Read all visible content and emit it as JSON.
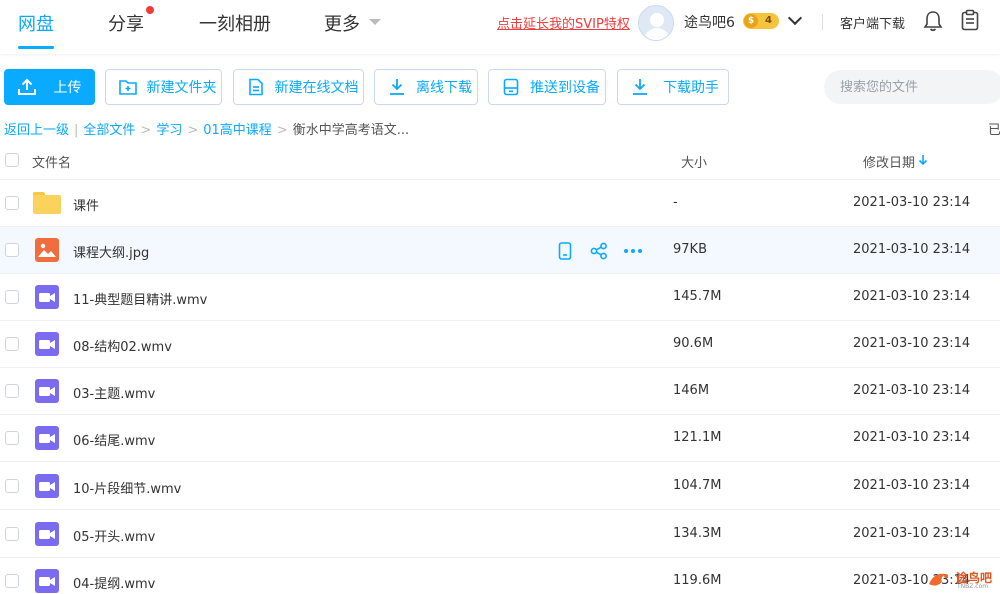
{
  "nav": {
    "tabs": [
      {
        "label": "网盘",
        "active": true
      },
      {
        "label": "分享",
        "active": false,
        "dot": true
      },
      {
        "label": "一刻相册",
        "active": false
      },
      {
        "label": "更多",
        "active": false,
        "dropdown": true
      }
    ]
  },
  "header": {
    "promo": "点击延长我的SVIP特权",
    "username": "途鸟吧6",
    "vip_level": "4",
    "vip_coin": "$",
    "client_download": "客户端下载",
    "bell_icon": "bell-icon",
    "clipboard_icon": "clipboard-icon"
  },
  "toolbar": {
    "upload": "上传",
    "new_folder": "新建文件夹",
    "new_doc": "新建在线文档",
    "offline_download": "离线下载",
    "push_device": "推送到设备",
    "download_helper": "下载助手",
    "search_placeholder": "搜索您的文件"
  },
  "breadcrumb": {
    "back": "返回上一级",
    "items": [
      "全部文件",
      "学习",
      "01高中课程"
    ],
    "current": "衡水中学高考语文...",
    "right_cut": "已"
  },
  "table": {
    "col_name": "文件名",
    "col_size": "大小",
    "col_date": "修改日期",
    "rows": [
      {
        "name": "课件",
        "size": "-",
        "date": "2021-03-10 23:14",
        "type": "folder"
      },
      {
        "name": "课程大纲.jpg",
        "size": "97KB",
        "date": "2021-03-10 23:14",
        "type": "image"
      },
      {
        "name": "11-典型题目精讲.wmv",
        "size": "145.7M",
        "date": "2021-03-10 23:14",
        "type": "video"
      },
      {
        "name": "08-结构02.wmv",
        "size": "90.6M",
        "date": "2021-03-10 23:14",
        "type": "video"
      },
      {
        "name": "03-主题.wmv",
        "size": "146M",
        "date": "2021-03-10 23:14",
        "type": "video"
      },
      {
        "name": "06-结尾.wmv",
        "size": "121.1M",
        "date": "2021-03-10 23:14",
        "type": "video"
      },
      {
        "name": "10-片段细节.wmv",
        "size": "104.7M",
        "date": "2021-03-10 23:14",
        "type": "video"
      },
      {
        "name": "05-开头.wmv",
        "size": "134.3M",
        "date": "2021-03-10 23:14",
        "type": "video"
      },
      {
        "name": "04-提纲.wmv",
        "size": "119.6M",
        "date": "2021-03-10 23:14",
        "type": "video"
      }
    ]
  },
  "watermark": {
    "text": "途鸟吧",
    "sub": "TNBZ.com"
  },
  "colors": {
    "accent": "#09AAFF",
    "promo": "#ef3d3d",
    "video_icon": "#7b6bf0",
    "image_icon": "#f26d3d",
    "folder": "#fbd25b"
  }
}
